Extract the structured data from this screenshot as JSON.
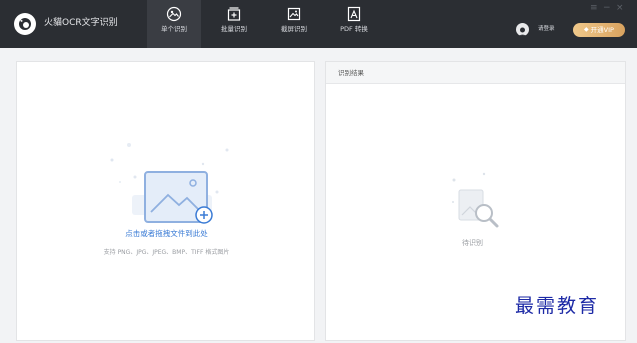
{
  "app": {
    "title": "火貓OCR文字识别"
  },
  "tabs": [
    {
      "label": "单个识别",
      "icon": "single-scan-icon",
      "active": true
    },
    {
      "label": "批量识别",
      "icon": "batch-add-icon",
      "active": false
    },
    {
      "label": "截屏识别",
      "icon": "screenshot-crop-icon",
      "active": false
    },
    {
      "label": "PDF 转换",
      "icon": "pdf-convert-icon",
      "active": false
    }
  ],
  "window": {
    "menu": "≡",
    "minimize": "−",
    "close": "×"
  },
  "user": {
    "login_label": "请登录",
    "vip_label": "开通VIP",
    "vip_color": "#e0ad6c"
  },
  "upload": {
    "drop_label": "点击或者拖拽文件到此处",
    "formats_label": "支持 PNG、JPG、JPEG、BMP、TIFF 格式图片",
    "accent": "#3a7bd5"
  },
  "result": {
    "title": "识别结果",
    "status": "待识别"
  },
  "watermark": "最需教育"
}
